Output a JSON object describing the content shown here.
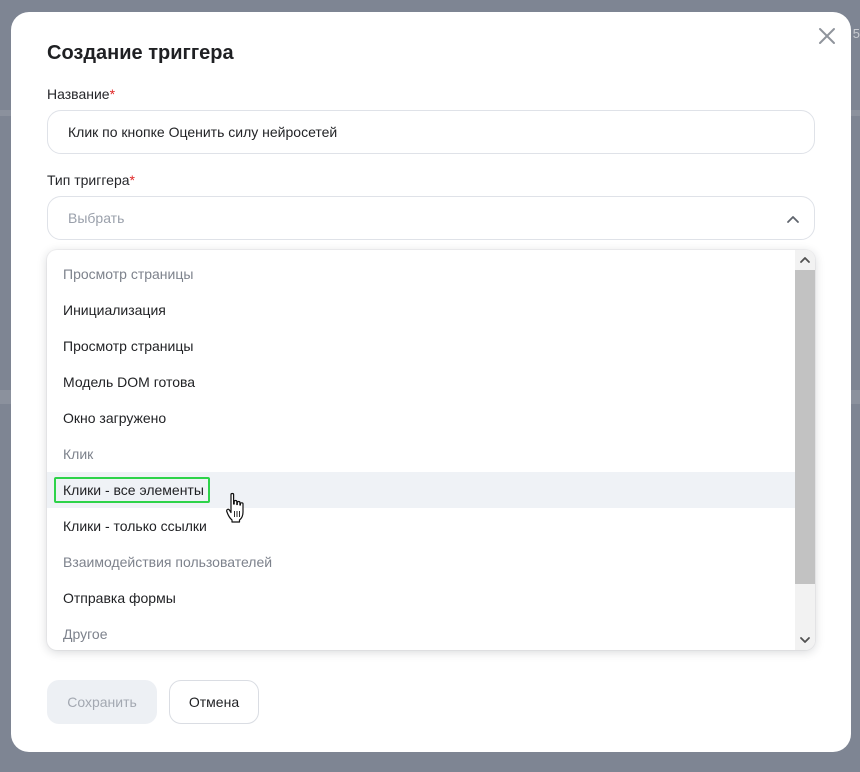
{
  "modal": {
    "title": "Создание триггера",
    "close_icon": "close-icon"
  },
  "background": {
    "edge_text": "5"
  },
  "name_field": {
    "label": "Название",
    "required_mark": "*",
    "value": "Клик по кнопке Оценить силу нейросетей"
  },
  "type_field": {
    "label": "Тип триггера",
    "required_mark": "*",
    "placeholder": "Выбрать",
    "expanded": true,
    "icon": "chevron-up-icon"
  },
  "dropdown": {
    "options": [
      {
        "label": "Просмотр страницы",
        "kind": "group"
      },
      {
        "label": "Инициализация",
        "kind": "option"
      },
      {
        "label": "Просмотр страницы",
        "kind": "option"
      },
      {
        "label": "Модель DOM готова",
        "kind": "option"
      },
      {
        "label": "Окно загружено",
        "kind": "option"
      },
      {
        "label": "Клик",
        "kind": "group"
      },
      {
        "label": "Клики - все элементы",
        "kind": "option",
        "hovered": true,
        "highlighted": true
      },
      {
        "label": "Клики - только ссылки",
        "kind": "option"
      },
      {
        "label": "Взаимодействия пользователей",
        "kind": "group"
      },
      {
        "label": "Отправка формы",
        "kind": "option"
      },
      {
        "label": "Другое",
        "kind": "group"
      }
    ],
    "highlight_color": "#2ed34a",
    "scroll_up_icon": "chevron-up-small-icon",
    "scroll_down_icon": "chevron-down-small-icon"
  },
  "footer": {
    "save_label": "Сохранить",
    "save_disabled": true,
    "cancel_label": "Отмена"
  },
  "colors": {
    "overlay": "#7e8593",
    "required": "#e02525",
    "group_text": "#7d828c",
    "hover_row": "#eff2f6"
  }
}
